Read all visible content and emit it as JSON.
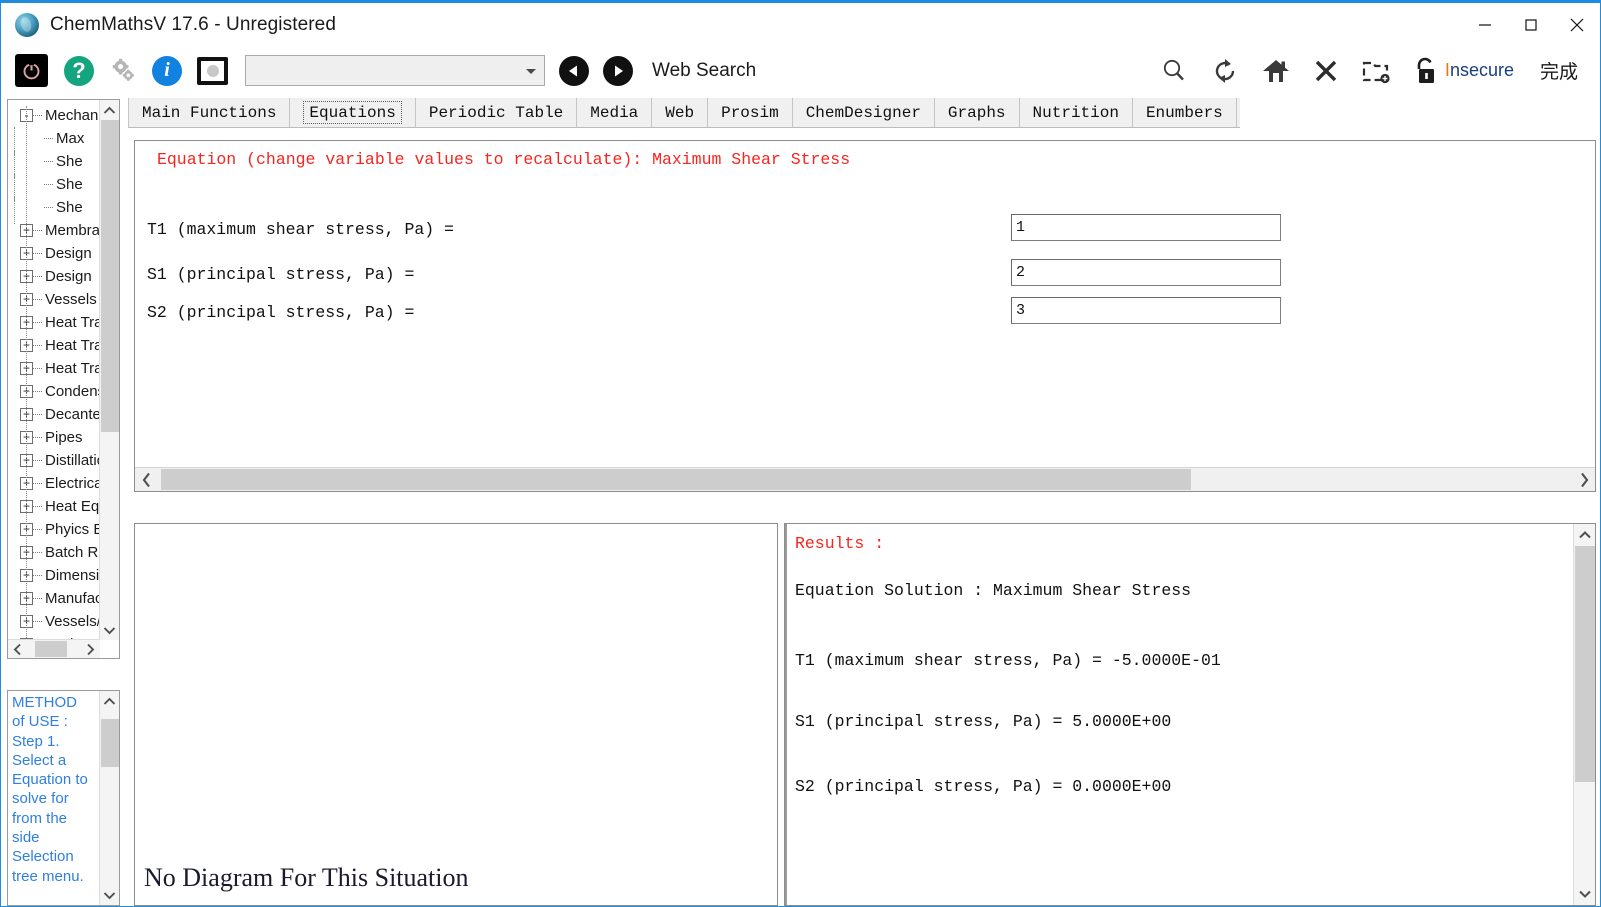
{
  "window": {
    "title": "ChemMathsV 17.6 - Unregistered",
    "app_icon": "globe-icon",
    "minimize": "minimize-icon",
    "maximize": "maximize-icon",
    "close": "close-icon",
    "accent_color": "#1f8ce0"
  },
  "toolbar": {
    "power_icon": "power-icon",
    "help_icon": "question-mark-icon",
    "gear_icon": "gear-icon",
    "info_icon": "info-icon",
    "screen_icon": "monitor-icon",
    "address_value": "",
    "address_placeholder": "",
    "back_icon": "back-arrow-icon",
    "forward_icon": "forward-arrow-icon",
    "web_search_label": "Web Search",
    "search_icon": "magnifier-icon",
    "refresh_icon": "refresh-icon",
    "home_icon": "home-icon",
    "stop_icon": "close-x-icon",
    "newfolder_icon": "new-folder-icon",
    "lock_icon": "unlocked-padlock-icon",
    "insecure_label": "Insecure",
    "insecure_first_letter": "I",
    "insecure_rest": "nsecure",
    "done_label": "完成"
  },
  "tabs": [
    {
      "label": "Main Functions",
      "selected": false
    },
    {
      "label": "Equations",
      "selected": true
    },
    {
      "label": "Periodic Table",
      "selected": false
    },
    {
      "label": "Media",
      "selected": false
    },
    {
      "label": "Web",
      "selected": false
    },
    {
      "label": "Prosim",
      "selected": false
    },
    {
      "label": "ChemDesigner",
      "selected": false
    },
    {
      "label": "Graphs",
      "selected": false
    },
    {
      "label": "Nutrition",
      "selected": false
    },
    {
      "label": "Enumbers",
      "selected": false
    }
  ],
  "tree": {
    "nodes": [
      {
        "label": "Mechan",
        "toggle": "-",
        "child": false
      },
      {
        "label": "Max",
        "toggle": "",
        "child": true
      },
      {
        "label": "She",
        "toggle": "",
        "child": true
      },
      {
        "label": "She",
        "toggle": "",
        "child": true
      },
      {
        "label": "She",
        "toggle": "",
        "child": true
      },
      {
        "label": "Membra",
        "toggle": "+",
        "child": false
      },
      {
        "label": "Design",
        "toggle": "+",
        "child": false
      },
      {
        "label": "Design",
        "toggle": "+",
        "child": false
      },
      {
        "label": "Vessels",
        "toggle": "+",
        "child": false
      },
      {
        "label": "Heat Tra",
        "toggle": "+",
        "child": false
      },
      {
        "label": "Heat Tra",
        "toggle": "+",
        "child": false
      },
      {
        "label": "Heat Tra",
        "toggle": "+",
        "child": false
      },
      {
        "label": "Condens",
        "toggle": "+",
        "child": false
      },
      {
        "label": "Decante",
        "toggle": "+",
        "child": false
      },
      {
        "label": "Pipes",
        "toggle": "+",
        "child": false
      },
      {
        "label": "Distillatio",
        "toggle": "+",
        "child": false
      },
      {
        "label": "Electrica",
        "toggle": "+",
        "child": false
      },
      {
        "label": "Heat Eq",
        "toggle": "+",
        "child": false
      },
      {
        "label": "Phyics E",
        "toggle": "+",
        "child": false
      },
      {
        "label": "Batch R",
        "toggle": "+",
        "child": false
      },
      {
        "label": "Dimensi",
        "toggle": "+",
        "child": false
      },
      {
        "label": "Manufac",
        "toggle": "+",
        "child": false
      },
      {
        "label": "Vessels/",
        "toggle": "+",
        "child": false
      },
      {
        "label": "Maths G",
        "toggle": "+",
        "child": false
      }
    ],
    "scroll_up_icon": "chevron-up-icon",
    "scroll_down_icon": "chevron-down-icon",
    "scroll_left_icon": "chevron-left-icon",
    "scroll_right_icon": "chevron-right-icon"
  },
  "help": {
    "text": "METHOD of USE : Step 1. Select a Equation to solve for from the side Selection tree menu.",
    "scroll_down_icon": "chevron-down-icon"
  },
  "equation": {
    "title": "Equation (change variable values to recalculate): Maximum Shear Stress",
    "rows": [
      {
        "label": "T1 (maximum shear stress, Pa) =",
        "value": "1"
      },
      {
        "label": "S1 (principal stress, Pa) =",
        "value": "2"
      },
      {
        "label": "S2 (principal stress, Pa) =",
        "value": "3"
      }
    ],
    "scroll_left_icon": "chevron-left-icon",
    "scroll_right_icon": "chevron-right-icon"
  },
  "diagram": {
    "message": "No Diagram For This Situation"
  },
  "results": {
    "heading": "Results :",
    "solution_line": "Equation Solution : Maximum Shear Stress",
    "lines": [
      "T1 (maximum shear stress, Pa) =  -5.0000E-01",
      "S1 (principal stress, Pa) =  5.0000E+00",
      "S2 (principal stress, Pa) =  0.0000E+00"
    ],
    "scroll_up_icon": "chevron-up-icon",
    "scroll_down_icon": "chevron-down-icon"
  }
}
